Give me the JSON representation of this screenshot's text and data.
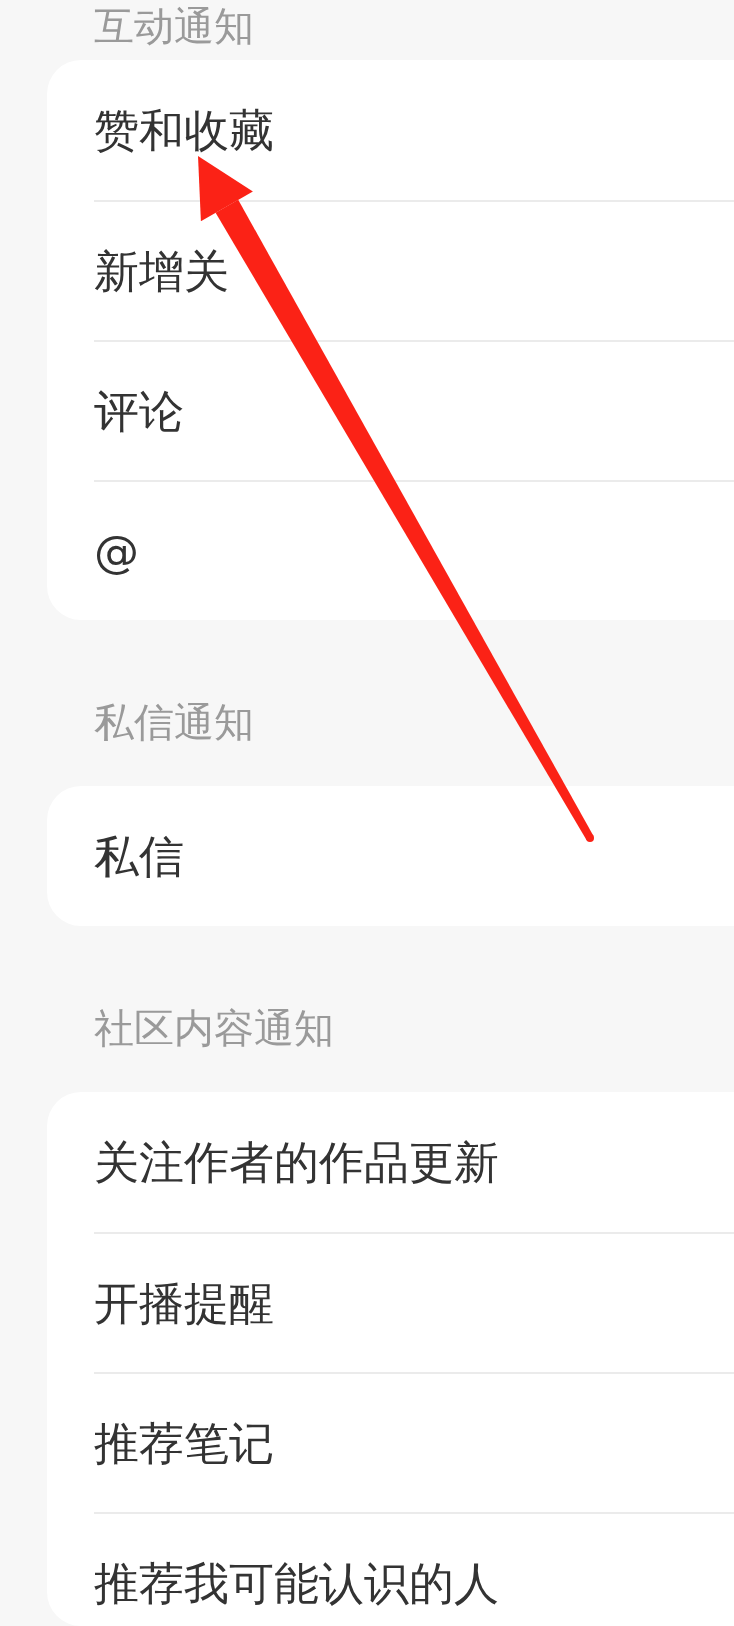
{
  "sections": [
    {
      "header": "互动通知",
      "items": [
        "赞和收藏",
        "新增关",
        "评论",
        "@"
      ]
    },
    {
      "header": "私信通知",
      "items": [
        "私信"
      ]
    },
    {
      "header": "社区内容通知",
      "items": [
        "关注作者的作品更新",
        "开播提醒",
        "推荐笔记",
        "推荐我可能认识的人"
      ]
    }
  ]
}
